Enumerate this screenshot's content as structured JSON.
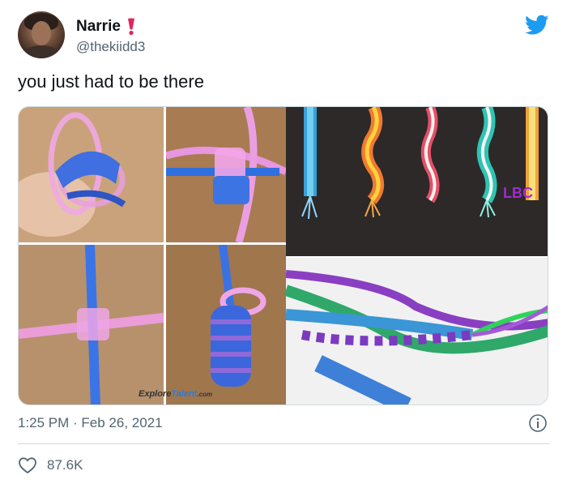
{
  "user": {
    "display_name": "Narrie",
    "handle": "@thekiidd3"
  },
  "tweet": {
    "text": "you just had to be there",
    "timestamp": "1:25 PM · Feb 26, 2021",
    "likes": "87.6K"
  },
  "media": {
    "watermark_brand": "Explore",
    "watermark_accent": "Talent",
    "watermark_suffix": ".com",
    "overlay_label": "LBC"
  },
  "icons": {
    "brand": "twitter-bird-icon",
    "emoji": "red-exclamation-icon",
    "info": "info-icon",
    "like": "heart-outline-icon"
  },
  "colors": {
    "twitter_blue": "#1d9bf0",
    "secondary_text": "#536471",
    "exclamation_red": "#e0245e"
  }
}
